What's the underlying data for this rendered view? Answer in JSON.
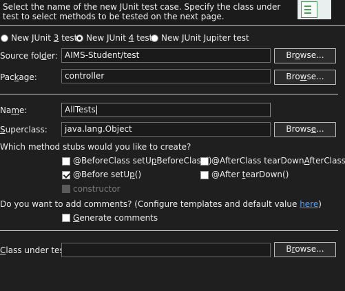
{
  "header": {
    "description": "Select the name of the new JUnit test case. Specify the class under test to select methods to be tested on the next page."
  },
  "junit_versions": [
    {
      "label": "New JUnit 3 test",
      "selected": false
    },
    {
      "label": "New JUnit 4 test",
      "selected": true
    },
    {
      "label": "New JUnit Jupiter test",
      "selected": false
    }
  ],
  "source_folder": {
    "label": "Source folder:",
    "value": "AIMS-Student/test",
    "browse_label": "Browse..."
  },
  "package": {
    "label": "Package:",
    "value": "controller",
    "browse_label": "Browse..."
  },
  "name": {
    "label": "Name:",
    "value": "AllTests"
  },
  "superclass": {
    "label": "Superclass:",
    "value": "java.lang.Object",
    "browse_label": "Browse..."
  },
  "method_stubs": {
    "question": "Which method stubs would you like to create?",
    "items": [
      {
        "label": "@BeforeClass setUpBeforeClass()",
        "checked": false,
        "enabled": true
      },
      {
        "label": "@AfterClass tearDownAfterClass()",
        "checked": false,
        "enabled": true
      },
      {
        "label": "@Before setUp()",
        "checked": true,
        "enabled": true
      },
      {
        "label": "@After tearDown()",
        "checked": false,
        "enabled": true
      },
      {
        "label": "constructor",
        "checked": false,
        "enabled": false
      }
    ]
  },
  "comments": {
    "question": "Do you want to add comments? (Configure templates and default value",
    "link": "here",
    "close": ")",
    "generate_label": "Generate comments",
    "generate_checked": false
  },
  "class_under_test": {
    "label": "Class under test:",
    "value": "",
    "browse_label": "Browse..."
  },
  "colors": {
    "background": "#1f1f1f",
    "link": "#4ea1ff",
    "text": "#ececec"
  }
}
